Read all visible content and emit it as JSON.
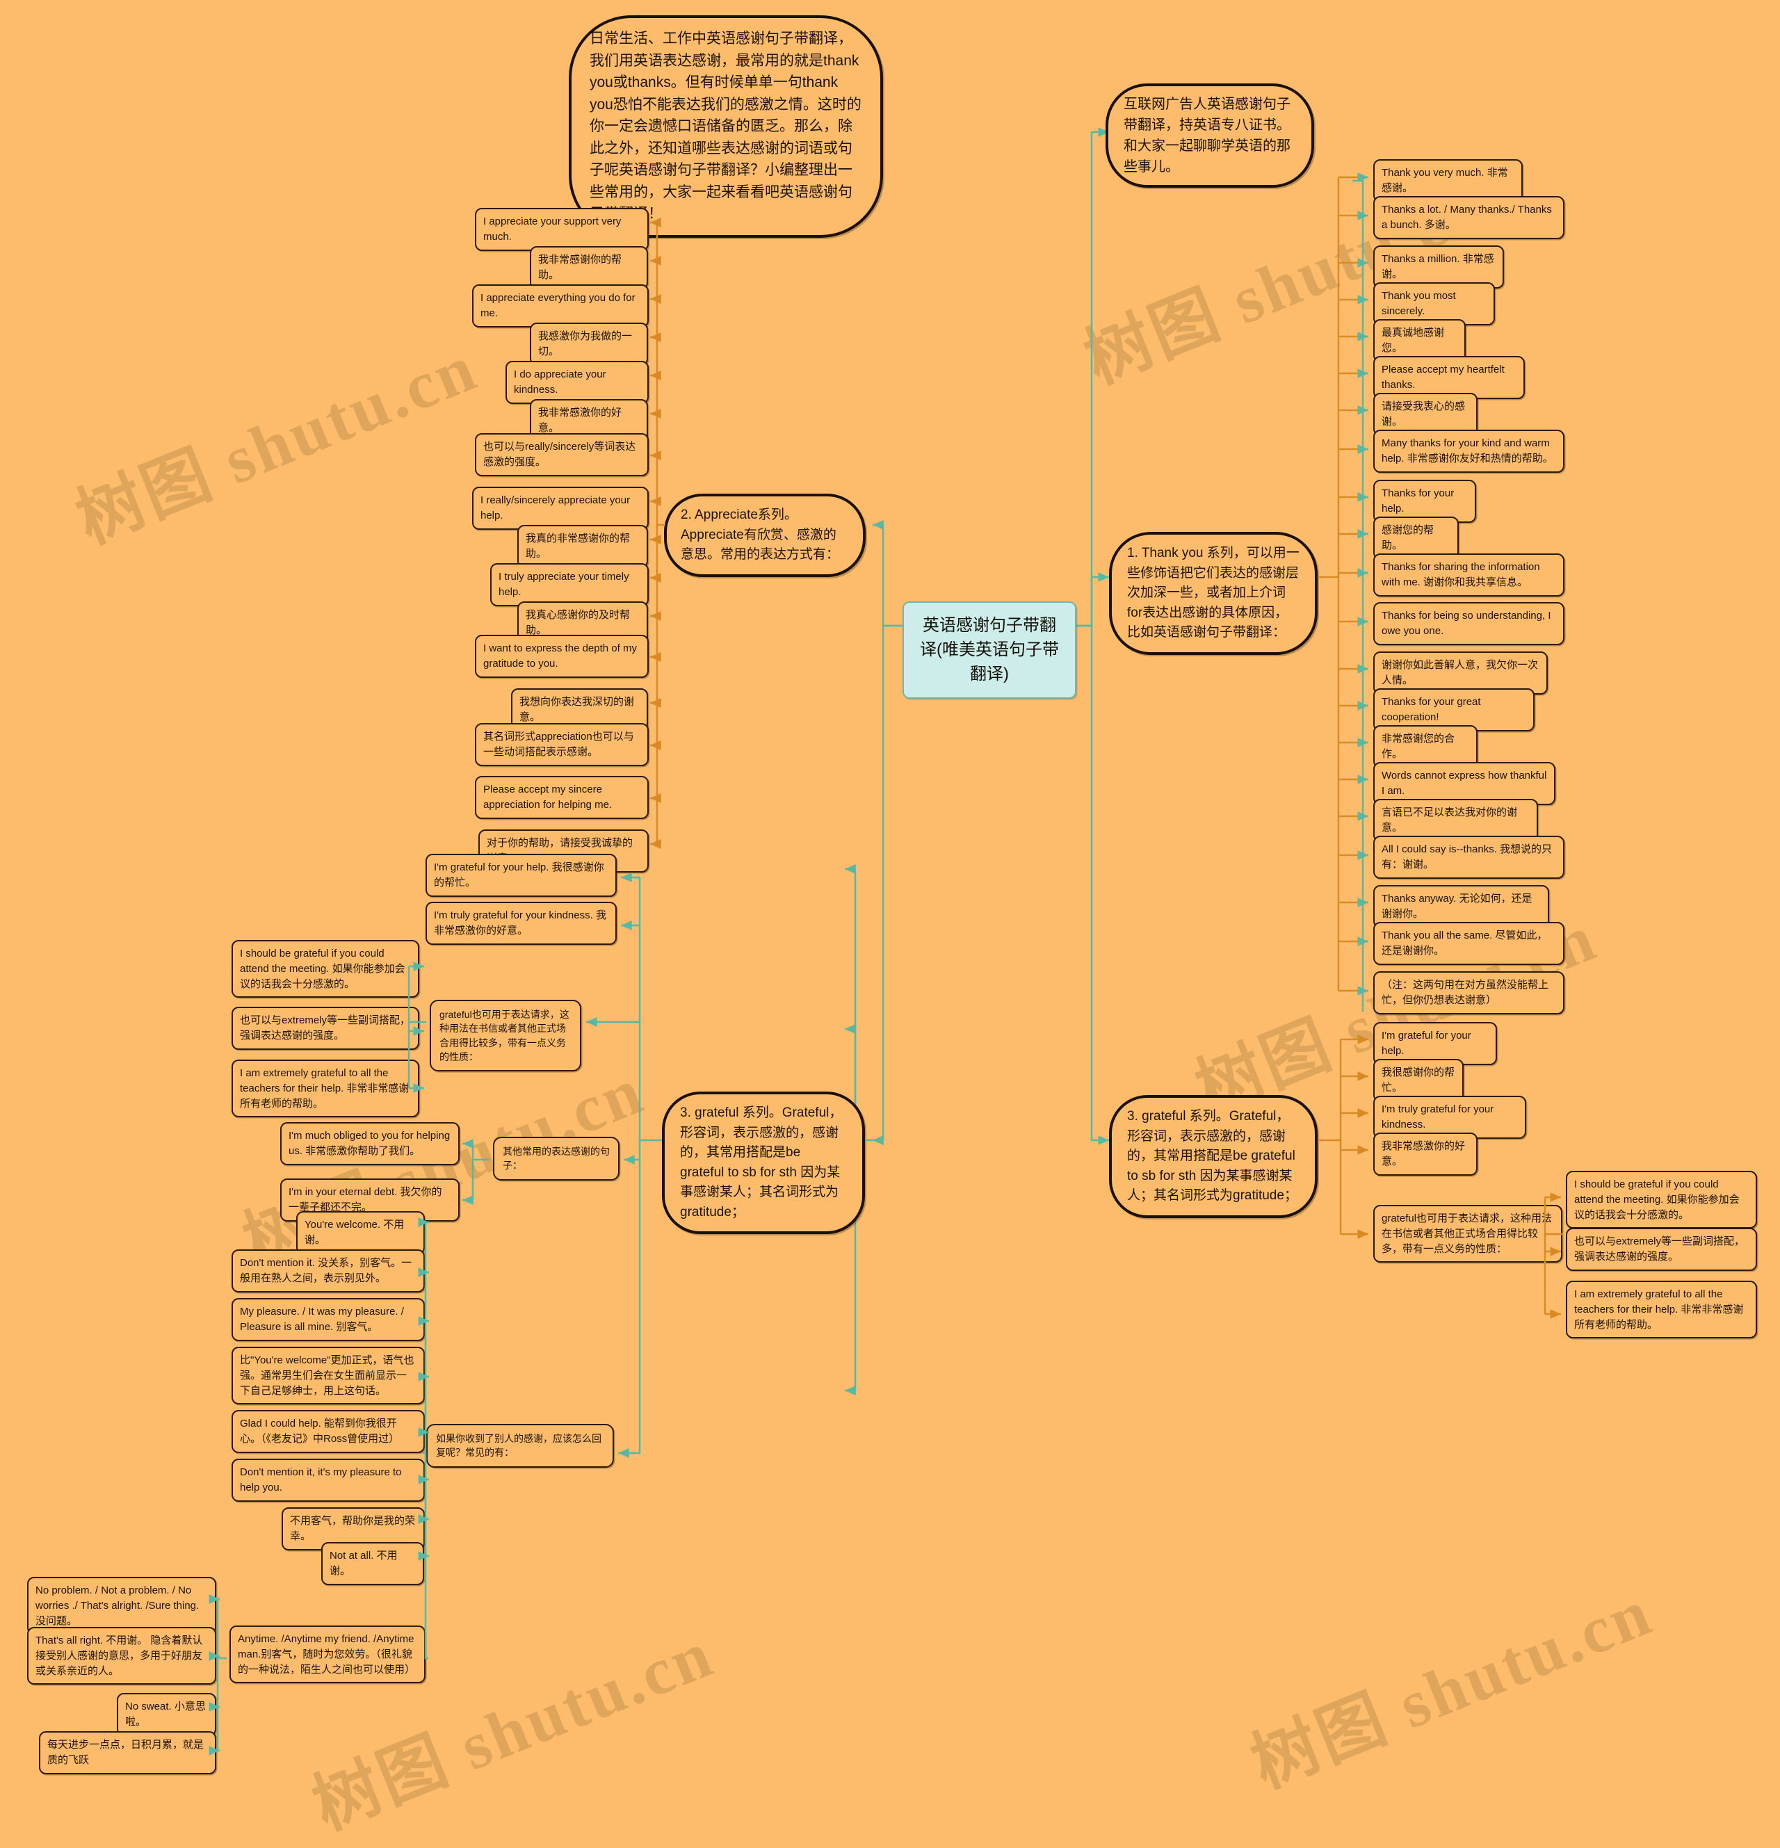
{
  "meta": {
    "watermark": "树图 shutu.cn",
    "background_color": "#FCBC6C",
    "root_fill_color": "#CCEDE9",
    "teal_link_color": "#57b9a4",
    "orange_link_color": "#d98a23"
  },
  "root": {
    "label": "英语感谢句子带翻译(唯美英语句子带翻译)"
  },
  "clouds": {
    "intro": "日常生活、工作中英语感谢句子带翻译，我们用英语表达感谢，最常用的就是thank you或thanks。但有时候单单一句thank you恐怕不能表达我们的感激之情。这时的你一定会遗憾口语储备的匮乏。那么，除此之外，还知道哪些表达感谢的词语或句子呢英语感谢句子带翻译？小编整理出一些常用的，大家一起来看看吧英语感谢句子带翻译！",
    "author": "互联网广告人英语感谢句子带翻译，持英语专八证书。和大家一起聊聊学英语的那些事儿。",
    "appreciate_branch": "2. Appreciate系列。Appreciate有欣赏、感激的意思。常用的表达方式有：",
    "grateful_branch_left": "3. grateful 系列。Grateful，形容词，表示感激的，感谢的，其常用搭配是be grateful to sb for sth 因为某事感谢某人；其名词形式为gratitude；",
    "thankyou_branch": "1. Thank you 系列，可以用一些修饰语把它们表达的感谢层次加深一些，或者加上介词for表达出感谢的具体原因，比如英语感谢句子带翻译：",
    "grateful_branch_right": "3. grateful 系列。Grateful，形容词，表示感激的，感谢的，其常用搭配是be grateful to sb for sth 因为某事感谢某人；其名词形式为gratitude；"
  },
  "appreciate_items": [
    "I appreciate your support very much.",
    "我非常感谢你的帮助。",
    "I appreciate everything you do for me.",
    "我感激你为我做的一切。",
    "I do appreciate your kindness.",
    "我非常感激你的好意。",
    "也可以与really/sincerely等词表达感激的强度。",
    "I really/sincerely appreciate your help.",
    "我真的非常感谢你的帮助。",
    "I truly appreciate your timely help.",
    "我真心感谢你的及时帮助。",
    "I want to express the depth of my gratitude to you.",
    "我想向你表达我深切的谢意。",
    "其名词形式appreciation也可以与一些动词搭配表示感谢。",
    "Please accept my sincere appreciation for helping me.",
    "对于你的帮助，请接受我诚挚的谢意!"
  ],
  "grateful_left_items": [
    "I'm grateful for your help. 我很感谢你的帮忙。",
    "I'm truly grateful for your kindness. 我非常感激你的好意。"
  ],
  "grateful_request_node": "grateful也可用于表达请求，这种用法在书信或者其他正式场合用得比较多，带有一点义务的性质：",
  "grateful_request_children": [
    "I should be grateful if you could attend the meeting. 如果你能参加会议的话我会十分感激的。",
    "也可以与extremely等一些副词搭配，强调表达感谢的强度。",
    "I am extremely grateful to all the teachers for their help. 非常非常感谢所有老师的帮助。"
  ],
  "other_expressions_node": "其他常用的表达感谢的句子：",
  "other_expressions_children": [
    "I'm much obliged to you for helping us. 非常感激你帮助了我们。",
    "I'm in your eternal debt. 我欠你的一辈子都还不完。"
  ],
  "reply_node": "如果你收到了别人的感谢，应该怎么回复呢？常见的有：",
  "reply_items": [
    "You're welcome. 不用谢。",
    "Don't mention it. 没关系，别客气。一般用在熟人之间，表示别见外。",
    "My pleasure. / It was my pleasure. / Pleasure is all mine. 别客气。",
    "比\"You're welcome\"更加正式，语气也强。通常男生们会在女生面前显示一下自己足够绅士，用上这句话。",
    "Glad I could help. 能帮到你我很开心。（《老友记》中Ross曾使用过）",
    "Don't mention it, it's my pleasure to help you.",
    "不用客气，帮助你是我的荣幸。",
    "Not at all. 不用谢。"
  ],
  "anytime_node": "Anytime. /Anytime my friend. /Anytime man.别客气，随时为您效劳。（很礼貌的一种说法，陌生人之间也可以使用）",
  "anytime_children": [
    "No problem. / Not a problem. / No worries ./ That's alright. /Sure thing. 没问题。",
    "That's all right. 不用谢。 隐含着默认接受别人感谢的意思，多用于好朋友或关系亲近的人。",
    "No sweat. 小意思啦。",
    "每天进步一点点，日积月累，就是质的飞跃"
  ],
  "thankyou_items": [
    "Thank you very much. 非常感谢。",
    "Thanks a lot. / Many thanks./ Thanks a bunch. 多谢。",
    "Thanks a million. 非常感谢。",
    "Thank you most sincerely.",
    "最真诚地感谢您。",
    "Please accept my heartfelt thanks.",
    "请接受我衷心的感谢。",
    "Many thanks for your kind and warm help. 非常感谢你友好和热情的帮助。",
    "Thanks for your help.",
    "感谢您的帮助。",
    "Thanks for sharing the information with me. 谢谢你和我共享信息。",
    "Thanks for being so understanding, I owe you one.",
    "谢谢你如此善解人意，我欠你一次人情。",
    "Thanks for your great cooperation!",
    "非常感谢您的合作。",
    "Words cannot express how thankful I am.",
    "言语已不足以表达我对你的谢意。",
    "All I could say is--thanks. 我想说的只有：谢谢。",
    "Thanks anyway. 无论如何，还是谢谢你。",
    "Thank you all the same. 尽管如此，还是谢谢你。",
    "（注：这两句用在对方虽然没能帮上忙，但你仍想表达谢意）"
  ],
  "grateful_right_items": [
    "I'm grateful for your help.",
    "我很感谢你的帮忙。",
    "I'm truly grateful for your kindness.",
    "我非常感激你的好意。"
  ],
  "grateful_right_request_node": "grateful也可用于表达请求，这种用法在书信或者其他正式场合用得比较多，带有一点义务的性质：",
  "grateful_right_request_children": [
    "I should be grateful if you could attend the meeting. 如果你能参加会议的话我会十分感激的。",
    "也可以与extremely等一些副词搭配，强调表达感谢的强度。",
    "I am extremely grateful to all the teachers for their help. 非常非常感谢所有老师的帮助。"
  ]
}
